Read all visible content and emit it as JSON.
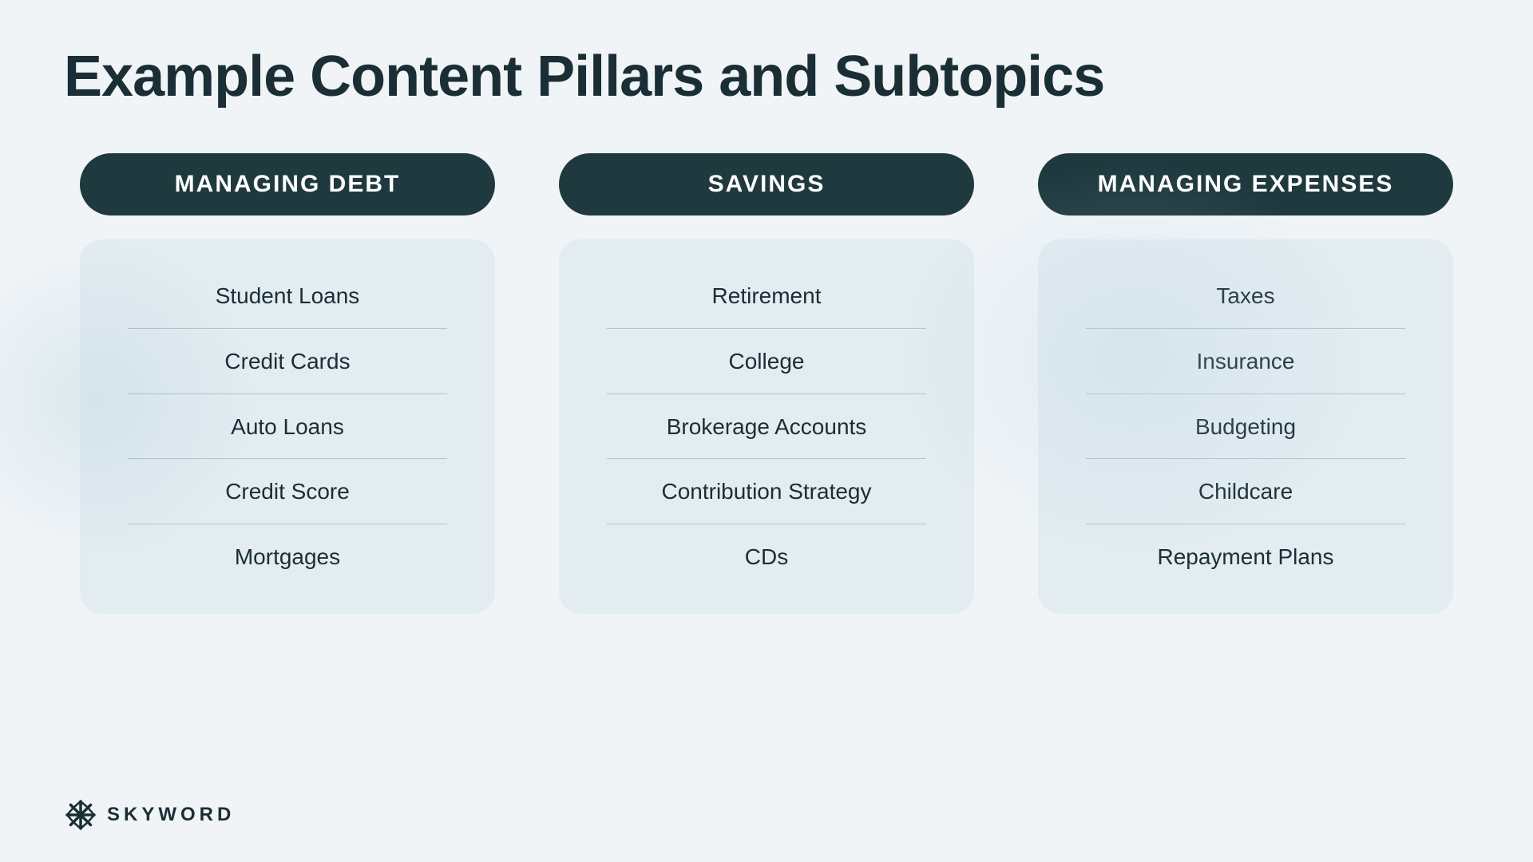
{
  "page": {
    "title": "Example Content Pillars and Subtopics",
    "background_color": "#f0f4f7"
  },
  "pillars": [
    {
      "id": "managing-debt",
      "header": "MANAGING DEBT",
      "subtopics": [
        "Student Loans",
        "Credit Cards",
        "Auto Loans",
        "Credit Score",
        "Mortgages"
      ]
    },
    {
      "id": "savings",
      "header": "SAVINGS",
      "subtopics": [
        "Retirement",
        "College",
        "Brokerage Accounts",
        "Contribution Strategy",
        "CDs"
      ]
    },
    {
      "id": "managing-expenses",
      "header": "MANAGING EXPENSES",
      "subtopics": [
        "Taxes",
        "Insurance",
        "Budgeting",
        "Childcare",
        "Repayment Plans"
      ]
    }
  ],
  "logo": {
    "text": "SKYWORD"
  }
}
